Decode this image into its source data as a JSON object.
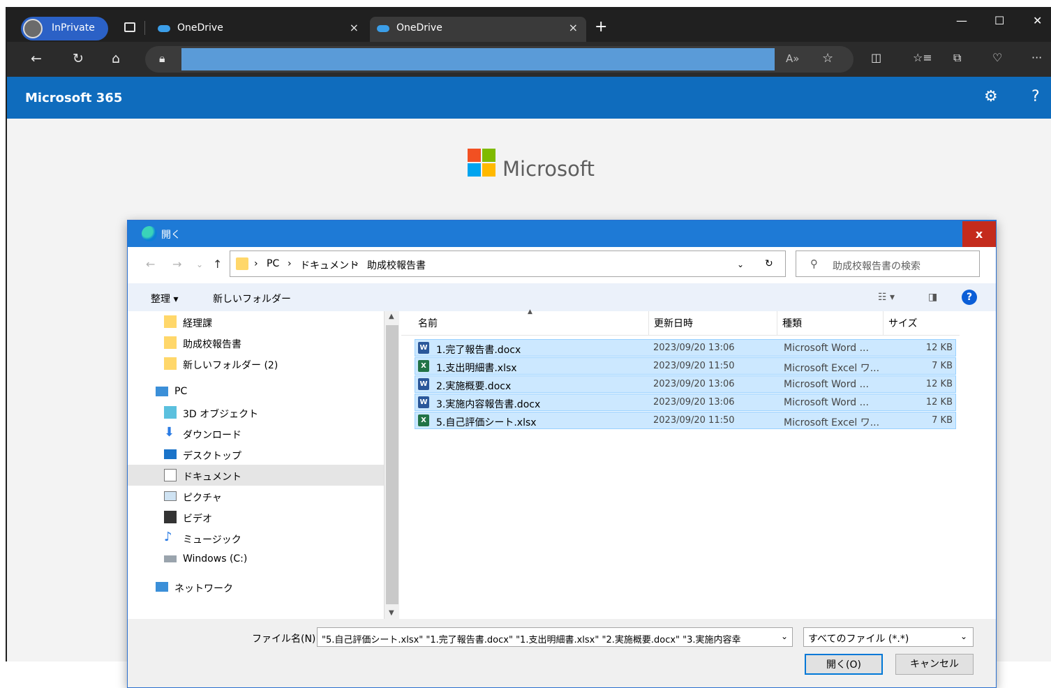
{
  "browser": {
    "inprivate_label": "InPrivate",
    "tabs": [
      {
        "title": "OneDrive",
        "close": "×"
      },
      {
        "title": "OneDrive",
        "close": "×"
      }
    ],
    "new_tab": "+",
    "window": {
      "minimize": "—",
      "maximize": "☐",
      "close": "✕"
    },
    "more": "···"
  },
  "m365": {
    "title": "Microsoft 365",
    "settings_icon": "⚙",
    "help_icon": "?"
  },
  "page": {
    "brand": "Microsoft"
  },
  "dialog": {
    "title": "開く",
    "close": "x",
    "breadcrumb": [
      "PC",
      "ドキュメント",
      "助成校報告書"
    ],
    "search_placeholder": "助成校報告書の検索",
    "toolbar": {
      "organize": "整理 ▾",
      "new_folder": "新しいフォルダー"
    },
    "nav_items": [
      {
        "label": "経理課",
        "icon": "folder-icon"
      },
      {
        "label": "助成校報告書",
        "icon": "folder-icon"
      },
      {
        "label": "新しいフォルダー (2)",
        "icon": "folder-icon"
      },
      {
        "label": "PC",
        "icon": "pc-icon"
      },
      {
        "label": "3D オブジェクト",
        "icon": "3d-objects-icon"
      },
      {
        "label": "ダウンロード",
        "icon": "download-icon"
      },
      {
        "label": "デスクトップ",
        "icon": "desktop-icon"
      },
      {
        "label": "ドキュメント",
        "icon": "documents-icon"
      },
      {
        "label": "ピクチャ",
        "icon": "pictures-icon"
      },
      {
        "label": "ビデオ",
        "icon": "videos-icon"
      },
      {
        "label": "ミュージック",
        "icon": "music-icon"
      },
      {
        "label": "Windows (C:)",
        "icon": "drive-icon"
      },
      {
        "label": "ネットワーク",
        "icon": "network-icon"
      }
    ],
    "columns": {
      "name": "名前",
      "date": "更新日時",
      "type": "種類",
      "size": "サイズ"
    },
    "files": [
      {
        "name": "1.完了報告書.docx",
        "date": "2023/09/20 13:06",
        "type": "Microsoft Word ...",
        "size": "12 KB",
        "kind": "word"
      },
      {
        "name": "1.支出明細書.xlsx",
        "date": "2023/09/20 11:50",
        "type": "Microsoft Excel ワ...",
        "size": "7 KB",
        "kind": "excel"
      },
      {
        "name": "2.実施概要.docx",
        "date": "2023/09/20 13:06",
        "type": "Microsoft Word ...",
        "size": "12 KB",
        "kind": "word"
      },
      {
        "name": "3.実施内容報告書.docx",
        "date": "2023/09/20 13:06",
        "type": "Microsoft Word ...",
        "size": "12 KB",
        "kind": "word"
      },
      {
        "name": "5.自己評価シート.xlsx",
        "date": "2023/09/20 11:50",
        "type": "Microsoft Excel ワ...",
        "size": "7 KB",
        "kind": "excel"
      }
    ],
    "filename_label": "ファイル名(N):",
    "filename_value": "\"5.自己評価シート.xlsx\" \"1.完了報告書.docx\" \"1.支出明細書.xlsx\" \"2.実施概要.docx\" \"3.実施内容幸",
    "filetype_value": "すべてのファイル (*.*)",
    "open_button": "開く(O)",
    "cancel_button": "キャンセル"
  }
}
